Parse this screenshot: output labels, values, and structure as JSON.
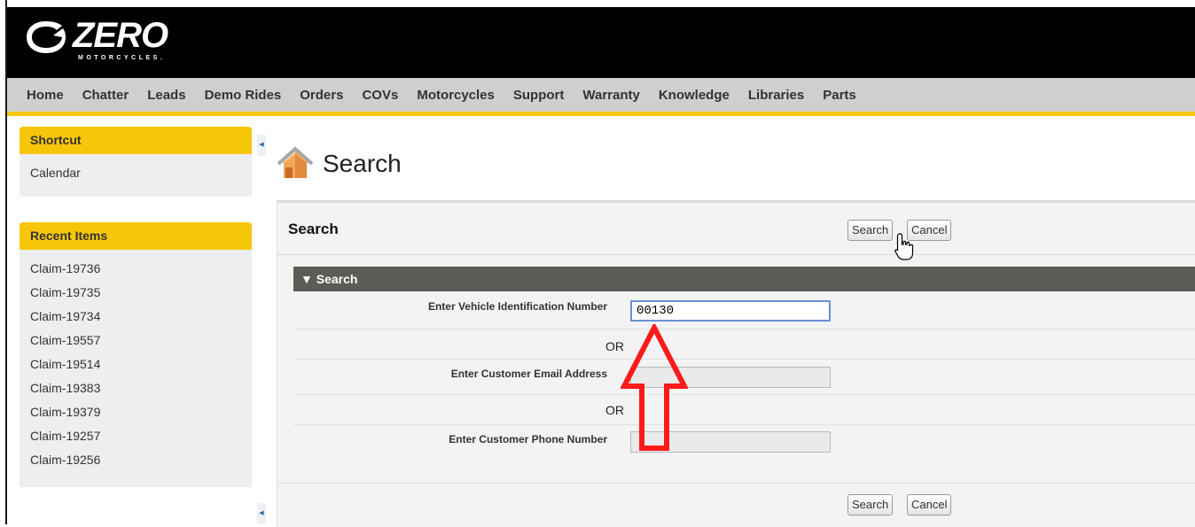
{
  "brand": {
    "name": "ZERO",
    "tagline": "MOTORCYCLES."
  },
  "nav": {
    "items": [
      "Home",
      "Chatter",
      "Leads",
      "Demo Rides",
      "Orders",
      "COVs",
      "Motorcycles",
      "Support",
      "Warranty",
      "Knowledge",
      "Libraries",
      "Parts"
    ]
  },
  "sidebar": {
    "shortcut": {
      "title": "Shortcut",
      "items": [
        "Calendar"
      ]
    },
    "recent": {
      "title": "Recent Items",
      "items": [
        "Claim-19736",
        "Claim-19735",
        "Claim-19734",
        "Claim-19557",
        "Claim-19514",
        "Claim-19383",
        "Claim-19379",
        "Claim-19257",
        "Claim-19256"
      ]
    }
  },
  "page": {
    "title": "Search"
  },
  "panel": {
    "title": "Search",
    "search_label": "Search",
    "cancel_label": "Cancel",
    "section_title": "Search",
    "or_text": "OR",
    "fields": {
      "vin": {
        "label": "Enter Vehicle Identification Number",
        "value": "00130"
      },
      "email": {
        "label": "Enter Customer Email Address",
        "value": ""
      },
      "phone": {
        "label": "Enter Customer Phone Number",
        "value": ""
      }
    }
  },
  "colors": {
    "header": "#000000",
    "nav_bg": "#cfcfcf",
    "accent": "#f6c60a",
    "section_header": "#5c5c57",
    "annotation_arrow": "#ff1a1a"
  },
  "icons": {
    "logo": "zero-logo-icon",
    "page": "house-icon",
    "cursor": "hand-pointer-icon",
    "collapse": "chevron-left-icon",
    "section_toggle": "triangle-down-icon"
  }
}
